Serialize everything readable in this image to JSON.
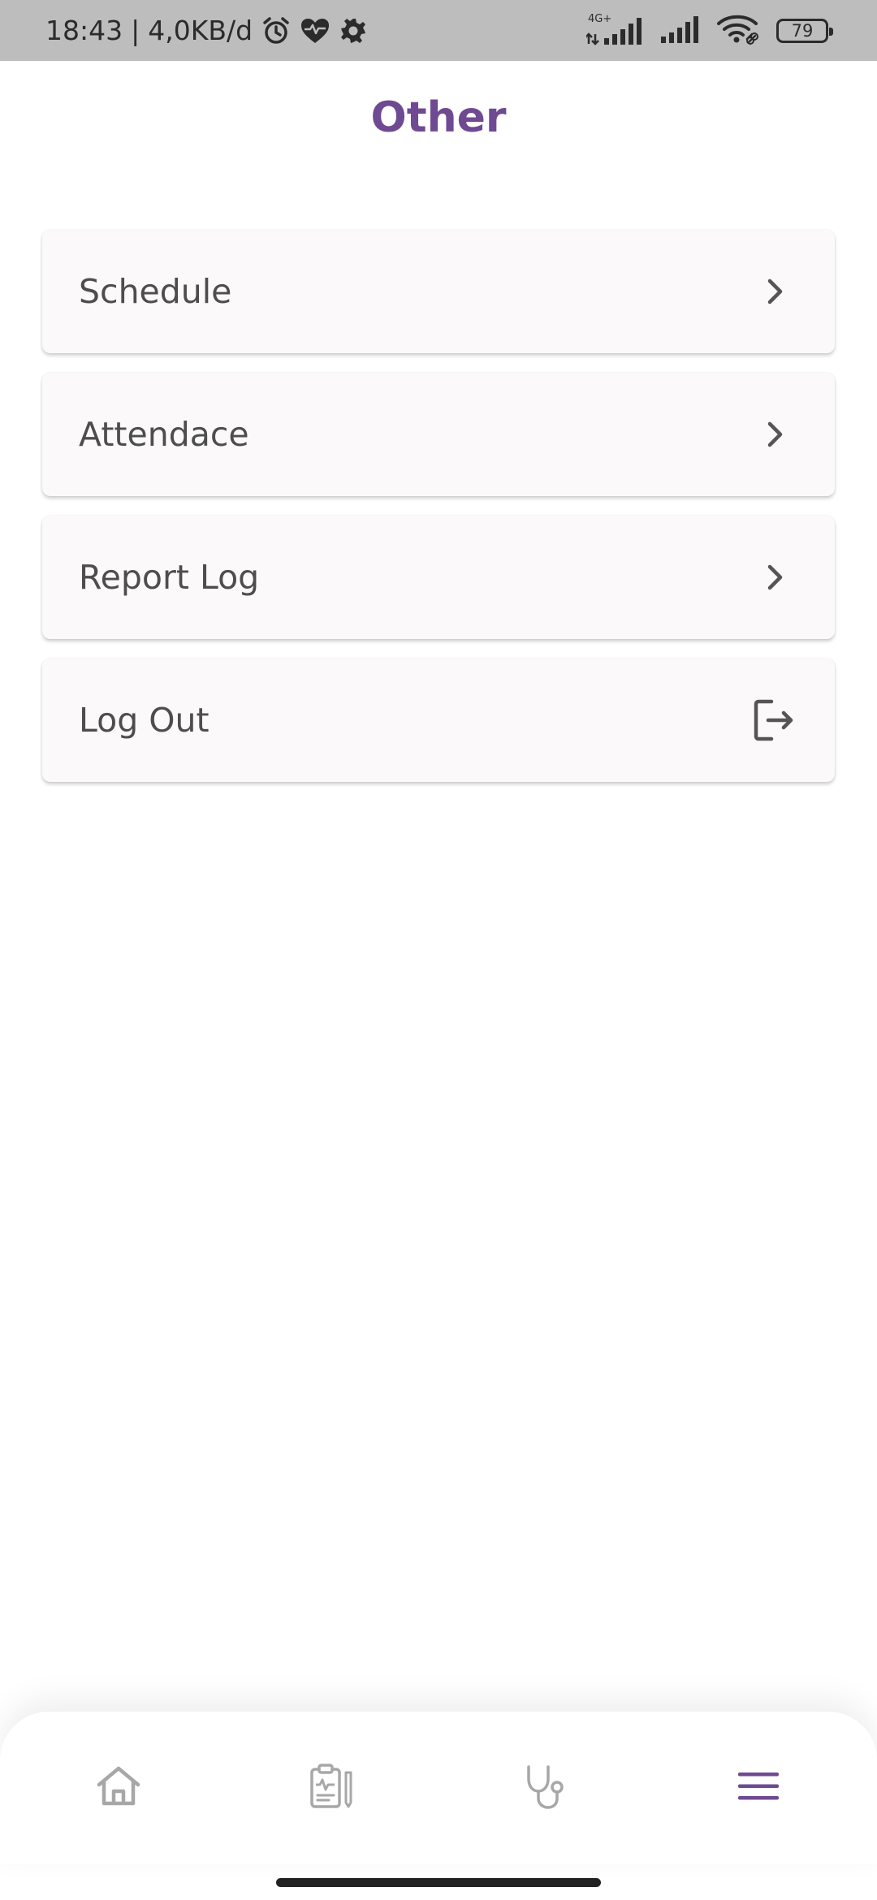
{
  "status_bar": {
    "time": "18:43",
    "separator": "|",
    "net_speed": "4,0KB/d",
    "network_type": "4G+",
    "battery": "79",
    "icons": [
      "alarm-icon",
      "heart-rate-icon",
      "settings-icon",
      "signal-icon",
      "signal-icon",
      "wifi-icon",
      "battery-icon"
    ]
  },
  "header": {
    "title": "Other"
  },
  "menu": {
    "items": [
      {
        "label": "Schedule",
        "icon": "chevron-right-icon"
      },
      {
        "label": "Attendace",
        "icon": "chevron-right-icon"
      },
      {
        "label": "Report Log",
        "icon": "chevron-right-icon"
      },
      {
        "label": "Log Out",
        "icon": "logout-icon"
      }
    ]
  },
  "bottom_nav": {
    "items": [
      {
        "icon": "home-icon",
        "active": false
      },
      {
        "icon": "clipboard-icon",
        "active": false
      },
      {
        "icon": "stethoscope-icon",
        "active": false
      },
      {
        "icon": "menu-icon",
        "active": true
      }
    ]
  },
  "colors": {
    "accent": "#6f4a93",
    "status_bar": "#bdbdbd",
    "card": "#fbf9fa",
    "text": "#4d4d4d",
    "inactive_icon": "#a7a7a7"
  }
}
